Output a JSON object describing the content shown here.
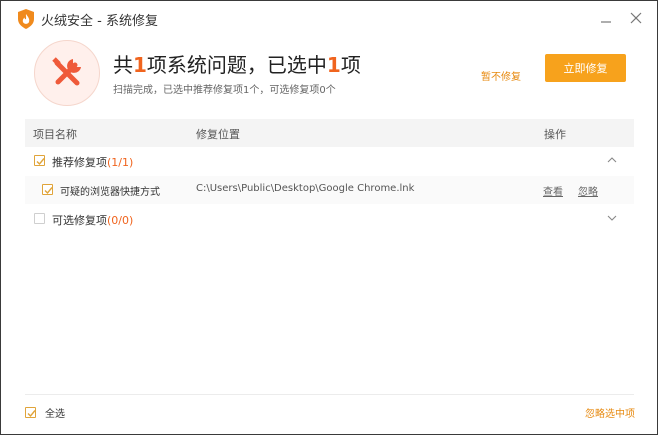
{
  "window": {
    "title": "火绒安全 - 系统修复"
  },
  "summary": {
    "headline_prefix": "共",
    "headline_total": "1",
    "headline_mid": "项系统问题，已选中",
    "headline_selected": "1",
    "headline_suffix": "项",
    "subline": "扫描完成，已选中推荐修复项1个，可选修复项0个",
    "skip_label": "暂不修复",
    "fix_label": "立即修复"
  },
  "table": {
    "headers": [
      "项目名称",
      "修复位置",
      "操作"
    ],
    "groups": [
      {
        "label": "推荐修复项",
        "count": "(1/1)",
        "checked": true,
        "expanded": true,
        "items": [
          {
            "name": "可疑的浏览器快捷方式",
            "path": "C:\\Users\\Public\\Desktop\\Google Chrome.lnk",
            "view_label": "查看",
            "ignore_label": "忽略",
            "checked": true
          }
        ]
      },
      {
        "label": "可选修复项",
        "count": "(0/0)",
        "checked": false,
        "expanded": false,
        "items": []
      }
    ]
  },
  "footer": {
    "select_all_label": "全选",
    "ignore_selected_label": "忽略选中项"
  },
  "colors": {
    "accent_orange": "#f7a21c",
    "highlight_red": "#f0641e",
    "link_orange": "#e78a10"
  }
}
